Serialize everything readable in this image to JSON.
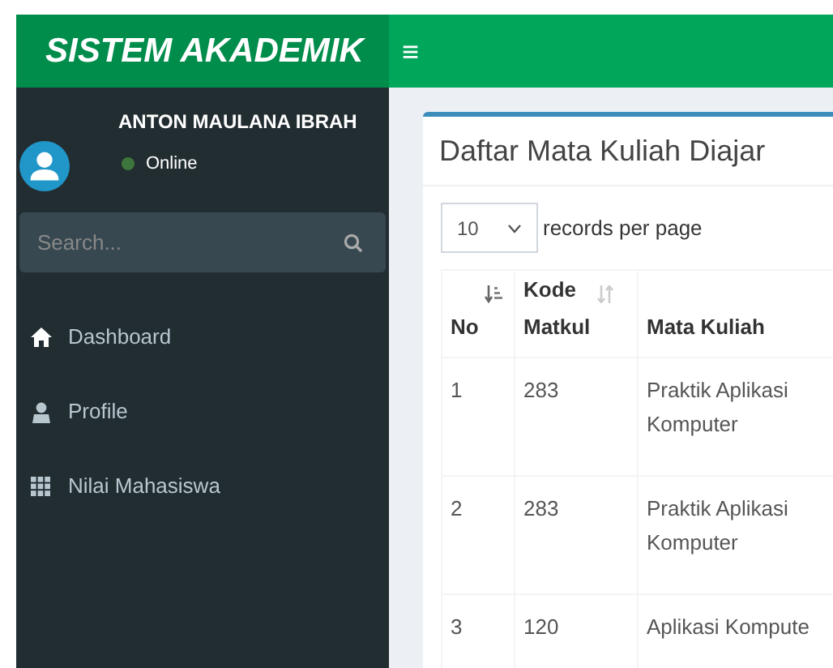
{
  "header": {
    "logo": "SISTEM AKADEMIK",
    "menu_toggle": "≡"
  },
  "user": {
    "name": "ANTON MAULANA IBRAH",
    "status": "Online"
  },
  "search": {
    "placeholder": "Search..."
  },
  "menu": [
    {
      "label": "Dashboard",
      "kind": "home"
    },
    {
      "label": "Profile",
      "kind": "person"
    },
    {
      "label": "Nilai Mahasiswa",
      "kind": "grid"
    }
  ],
  "box": {
    "title": "Daftar Mata Kuliah Diajar",
    "page_size": "10",
    "page_size_label": "records per page",
    "columns": [
      {
        "label": "No",
        "kind": "sorted"
      },
      {
        "label": "Kode Matkul",
        "kind": "sortable"
      },
      {
        "label": "Mata Kuliah",
        "kind": "plain"
      }
    ],
    "rows": [
      [
        "1",
        "283",
        "Praktik Aplikasi Komputer"
      ],
      [
        "2",
        "283",
        "Praktik Aplikasi Komputer"
      ],
      [
        "3",
        "120",
        "Aplikasi Kompute"
      ]
    ]
  }
}
